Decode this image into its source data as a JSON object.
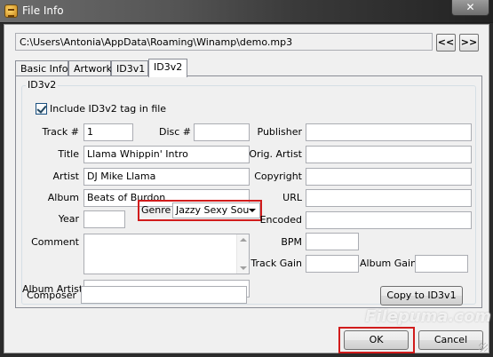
{
  "window": {
    "title": "File Info",
    "close_label": "✕"
  },
  "path": {
    "value": "C:\\Users\\Antonia\\AppData\\Roaming\\Winamp\\demo.mp3"
  },
  "nav": {
    "prev_label": "<<",
    "next_label": ">>"
  },
  "tabs": [
    {
      "label": "Basic Info"
    },
    {
      "label": "Artwork"
    },
    {
      "label": "ID3v1"
    },
    {
      "label": "ID3v2",
      "active": true
    }
  ],
  "id3v2": {
    "group_title": "ID3v2",
    "include_label": "Include ID3v2 tag in file",
    "include_checked": true,
    "labels": {
      "track": "Track #",
      "disc": "Disc #",
      "title": "Title",
      "artist": "Artist",
      "album": "Album",
      "year": "Year",
      "genre": "Genre",
      "comment": "Comment",
      "album_artist": "Album Artist",
      "composer": "Composer",
      "publisher": "Publisher",
      "orig_artist": "Orig. Artist",
      "copyright": "Copyright",
      "url": "URL",
      "encoded": "Encoded",
      "bpm": "BPM",
      "track_gain": "Track Gain",
      "album_gain": "Album Gain"
    },
    "values": {
      "track": "1",
      "disc": "",
      "title": "Llama Whippin' Intro",
      "artist": "DJ Mike Llama",
      "album": "Beats of Burdon",
      "year": "",
      "genre": "Jazzy Sexy Sou",
      "comment": "",
      "album_artist": "",
      "composer": "",
      "publisher": "",
      "orig_artist": "",
      "copyright": "",
      "url": "",
      "encoded": "",
      "bpm": "",
      "track_gain": "",
      "album_gain": ""
    },
    "copy_button": "Copy to ID3v1"
  },
  "buttons": {
    "ok": "OK",
    "cancel": "Cancel"
  },
  "watermark": "Filepuma.com"
}
